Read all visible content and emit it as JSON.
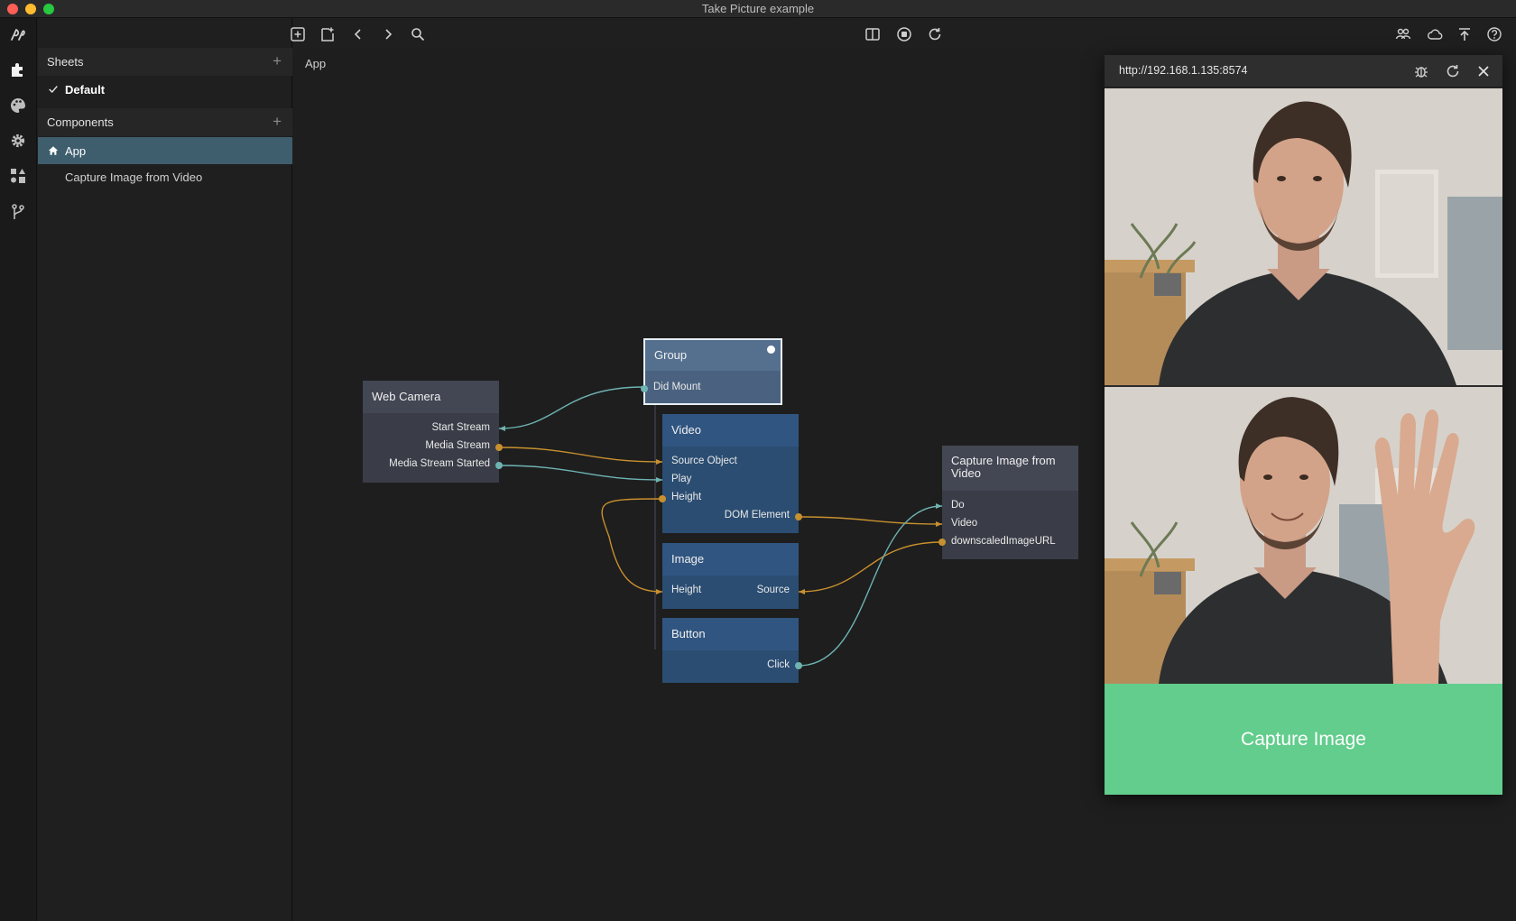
{
  "window": {
    "title": "Take Picture example"
  },
  "rail": {
    "icons": [
      "noodl-logo-icon",
      "puzzle-icon",
      "palette-icon",
      "gear-icon",
      "components-icon",
      "git-branch-icon"
    ]
  },
  "sidebar": {
    "sheets_label": "Sheets",
    "sheets_add": "+",
    "default_sheet": "Default",
    "components_label": "Components",
    "components_add": "+",
    "items": [
      {
        "label": "App",
        "selected": true
      },
      {
        "label": "Capture Image from Video",
        "selected": false
      }
    ]
  },
  "toolbar": {
    "left_icons": [
      "add-node-icon",
      "add-comment-icon",
      "back-icon",
      "forward-icon",
      "search-icon"
    ],
    "center_icons": [
      "split-view-icon",
      "stop-icon",
      "refresh-icon"
    ],
    "right_icons": [
      "users-icon",
      "cloud-icon",
      "deploy-icon",
      "help-icon"
    ]
  },
  "canvas": {
    "breadcrumb": "App",
    "nodes": {
      "web_camera": {
        "title": "Web Camera",
        "ports": [
          "Start Stream",
          "Media Stream",
          "Media Stream Started"
        ]
      },
      "group": {
        "title": "Group",
        "ports": [
          "Did Mount"
        ]
      },
      "video": {
        "title": "Video",
        "inputs": [
          "Source Object",
          "Play",
          "Height"
        ],
        "outputs": [
          "DOM Element"
        ]
      },
      "image": {
        "title": "Image",
        "inputs": [
          "Height"
        ],
        "outputs": [
          "Source"
        ]
      },
      "button": {
        "title": "Button",
        "outputs": [
          "Click"
        ]
      },
      "capture": {
        "title_line1": "Capture Image from",
        "title_line2": "Video",
        "inputs": [
          "Do",
          "Video",
          "downscaledImageURL"
        ]
      }
    },
    "colors": {
      "signal_wire": "#6fb3b3",
      "data_wire": "#c8902e"
    }
  },
  "preview": {
    "url": "http://192.168.1.135:8574",
    "icons": [
      "bug-icon",
      "reload-icon",
      "close-icon"
    ],
    "capture_button": "Capture Image",
    "capture_color": "#62cd8c"
  }
}
